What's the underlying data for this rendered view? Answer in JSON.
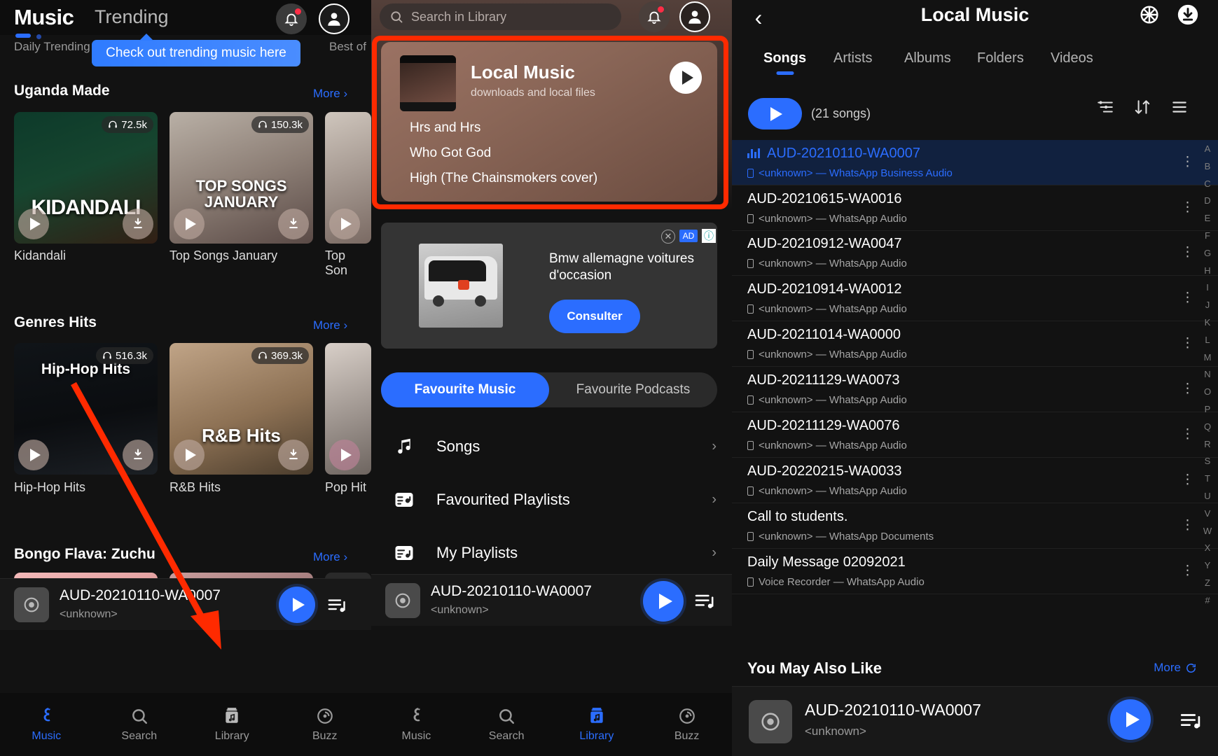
{
  "left_screen": {
    "header": {
      "title": "Music",
      "tab2": "Trending",
      "bell_icon": "bell-icon",
      "avatar_icon": "avatar-icon"
    },
    "subheaders": {
      "left": "Daily Trending",
      "right": "Best of"
    },
    "tooltip": "Check out trending music here",
    "sections": [
      {
        "title": "Uganda Made",
        "more": "More",
        "cards": [
          {
            "label": "Kidandali",
            "plays": "72.5k",
            "overlay": "KIDANDALI"
          },
          {
            "label": "Top Songs January",
            "plays": "150.3k",
            "overlay": "TOP SONGS JANUARY"
          },
          {
            "label": "Top Son",
            "plays": "",
            "overlay": ""
          }
        ]
      },
      {
        "title": "Genres Hits",
        "more": "More",
        "cards": [
          {
            "label": "Hip-Hop Hits",
            "plays": "516.3k",
            "overlay": "Hip-Hop Hits"
          },
          {
            "label": "R&B Hits",
            "plays": "369.3k",
            "overlay": "R&B Hits"
          },
          {
            "label": "Pop Hit",
            "plays": "",
            "overlay": ""
          }
        ]
      },
      {
        "title": "Bongo Flava: Zuchu",
        "more": "More",
        "cards": []
      }
    ],
    "mini_player": {
      "title": "AUD-20210110-WA0007",
      "subtitle": "<unknown>"
    },
    "tabbar": [
      {
        "label": "Music",
        "icon": "boomplay-b-icon",
        "active": true
      },
      {
        "label": "Search",
        "icon": "search-icon",
        "active": false
      },
      {
        "label": "Library",
        "icon": "library-icon",
        "active": false
      },
      {
        "label": "Buzz",
        "icon": "buzz-icon",
        "active": false
      }
    ]
  },
  "mid_screen": {
    "search_placeholder": "Search in Library",
    "bell_icon": "bell-icon",
    "avatar_icon": "avatar-icon",
    "local_music_card": {
      "title": "Local Music",
      "subtitle": "downloads and local files",
      "play_icon": "play-icon",
      "tracks": [
        "Hrs and Hrs",
        "Who Got God",
        "High (The Chainsmokers cover)"
      ]
    },
    "ad": {
      "text": "Bmw allemagne voitures d'occasion",
      "cta": "Consulter",
      "badge": "AD",
      "close_icon": "close-icon",
      "info_icon": "info-icon"
    },
    "segments": [
      {
        "label": "Favourite Music",
        "active": true
      },
      {
        "label": "Favourite Podcasts",
        "active": false
      }
    ],
    "rows": [
      {
        "label": "Songs",
        "icon": "music-note-icon"
      },
      {
        "label": "Favourited Playlists",
        "icon": "playlist-star-icon"
      },
      {
        "label": "My Playlists",
        "icon": "playlist-icon"
      }
    ],
    "mini_player": {
      "title": "AUD-20210110-WA0007",
      "subtitle": "<unknown>"
    },
    "tabbar": [
      {
        "label": "Music",
        "icon": "boomplay-b-icon",
        "active": false
      },
      {
        "label": "Search",
        "icon": "search-icon",
        "active": false
      },
      {
        "label": "Library",
        "icon": "library-icon",
        "active": true
      },
      {
        "label": "Buzz",
        "icon": "buzz-icon",
        "active": false
      }
    ]
  },
  "right_screen": {
    "header": {
      "title": "Local Music",
      "back_icon": "chevron-left-icon",
      "scan_icon": "scan-icon",
      "download_icon": "download-icon"
    },
    "tabs": [
      {
        "label": "Songs",
        "active": true
      },
      {
        "label": "Artists",
        "active": false
      },
      {
        "label": "Albums",
        "active": false
      },
      {
        "label": "Folders",
        "active": false
      },
      {
        "label": "Videos",
        "active": false
      }
    ],
    "play_all": {
      "icon": "play-icon",
      "count": "(21 songs)"
    },
    "toolbar_icons": [
      "filter-icon",
      "sort-icon",
      "list-icon"
    ],
    "songs": [
      {
        "title": "AUD-20210110-WA0007",
        "meta": "<unknown> — WhatsApp Business Audio",
        "selected": true
      },
      {
        "title": "AUD-20210615-WA0016",
        "meta": "<unknown> — WhatsApp Audio",
        "selected": false
      },
      {
        "title": "AUD-20210912-WA0047",
        "meta": "<unknown> — WhatsApp Audio",
        "selected": false
      },
      {
        "title": "AUD-20210914-WA0012",
        "meta": "<unknown> — WhatsApp Audio",
        "selected": false
      },
      {
        "title": "AUD-20211014-WA0000",
        "meta": "<unknown> — WhatsApp Audio",
        "selected": false
      },
      {
        "title": "AUD-20211129-WA0073",
        "meta": "<unknown> — WhatsApp Audio",
        "selected": false
      },
      {
        "title": "AUD-20211129-WA0076",
        "meta": "<unknown> — WhatsApp Audio",
        "selected": false
      },
      {
        "title": "AUD-20220215-WA0033",
        "meta": "<unknown> — WhatsApp Audio",
        "selected": false
      },
      {
        "title": "Call to students.",
        "meta": "<unknown> — WhatsApp Documents",
        "selected": false
      },
      {
        "title": "Daily Message 02092021",
        "meta": "Voice Recorder — WhatsApp Audio",
        "selected": false
      }
    ],
    "index_letters": [
      "A",
      "B",
      "C",
      "D",
      "E",
      "F",
      "G",
      "H",
      "I",
      "J",
      "K",
      "L",
      "M",
      "N",
      "O",
      "P",
      "Q",
      "R",
      "S",
      "T",
      "U",
      "V",
      "W",
      "X",
      "Y",
      "Z",
      "#"
    ],
    "you_may_also_like": {
      "title": "You May Also Like",
      "more": "More",
      "refresh_icon": "refresh-icon"
    },
    "suggestion": {
      "title": "AUD-20210110-WA0007",
      "subtitle": "<unknown>"
    }
  },
  "annotations": {
    "highlight_color": "#ff2a00",
    "arrow_target": "library-tab"
  }
}
